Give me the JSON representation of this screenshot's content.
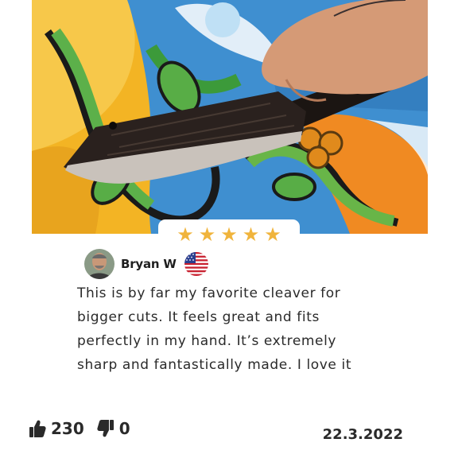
{
  "review": {
    "rating": 5,
    "rating_max": 5,
    "reviewer_name": "Bryan W",
    "country_flag_icon": "us-flag-icon",
    "text": "This is by far my favorite cleaver for\nbigger cuts.  It feels great and fits\nperfectly in my hand.  It’s extremely\nsharp and fantastically made.  I love it",
    "likes": "230",
    "dislikes": "0",
    "date": "22.3.2022"
  },
  "icons": {
    "like": "thumbs-up-icon",
    "dislike": "thumbs-down-icon",
    "star": "star-icon"
  },
  "colors": {
    "star": "#f0b43c",
    "text": "#2a2a2a"
  }
}
